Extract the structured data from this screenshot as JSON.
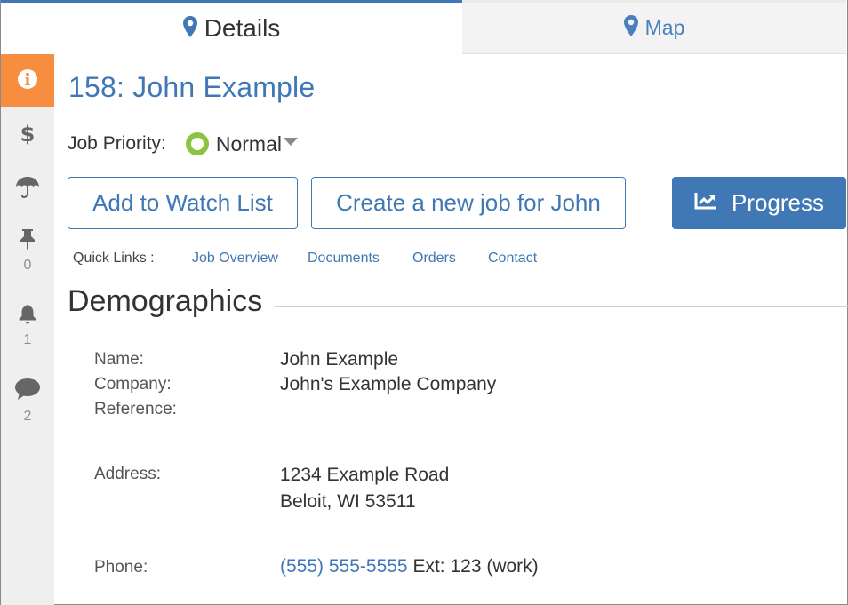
{
  "tabs": [
    {
      "label": "Details",
      "icon": "map-pin-icon",
      "active": true
    },
    {
      "label": "Map",
      "icon": "map-pin-icon",
      "active": false
    }
  ],
  "sidebar": {
    "items": [
      {
        "icon": "info-icon",
        "count": null,
        "active": true
      },
      {
        "icon": "dollar-icon",
        "count": null
      },
      {
        "icon": "umbrella-icon",
        "count": null
      },
      {
        "icon": "pushpin-icon",
        "count": "0"
      },
      {
        "icon": "bell-icon",
        "count": "1"
      },
      {
        "icon": "comment-icon",
        "count": "2"
      }
    ]
  },
  "job": {
    "title": "158: John Example",
    "priority_label": "Job Priority:",
    "priority_value": "Normal"
  },
  "buttons": {
    "watch": "Add to Watch List",
    "new_job": "Create a new job for John",
    "progress": "Progress"
  },
  "quick_links": {
    "label": "Quick Links :",
    "links": [
      "Job Overview",
      "Documents",
      "Orders",
      "Contact"
    ]
  },
  "demographics": {
    "title": "Demographics",
    "name_label": "Name:",
    "name": "John Example",
    "company_label": "Company:",
    "company": "John's Example Company",
    "reference_label": "Reference:",
    "address_label": "Address:",
    "address_line1": "1234 Example Road",
    "address_line2": "Beloit, WI 53511",
    "phone_label": "Phone:",
    "phone": "(555) 555-5555",
    "phone_ext": "Ext: 123 (work)"
  },
  "colors": {
    "accent": "#3f78b5",
    "sidebar_active": "#f78d3f",
    "priority_normal": "#8cc440"
  }
}
